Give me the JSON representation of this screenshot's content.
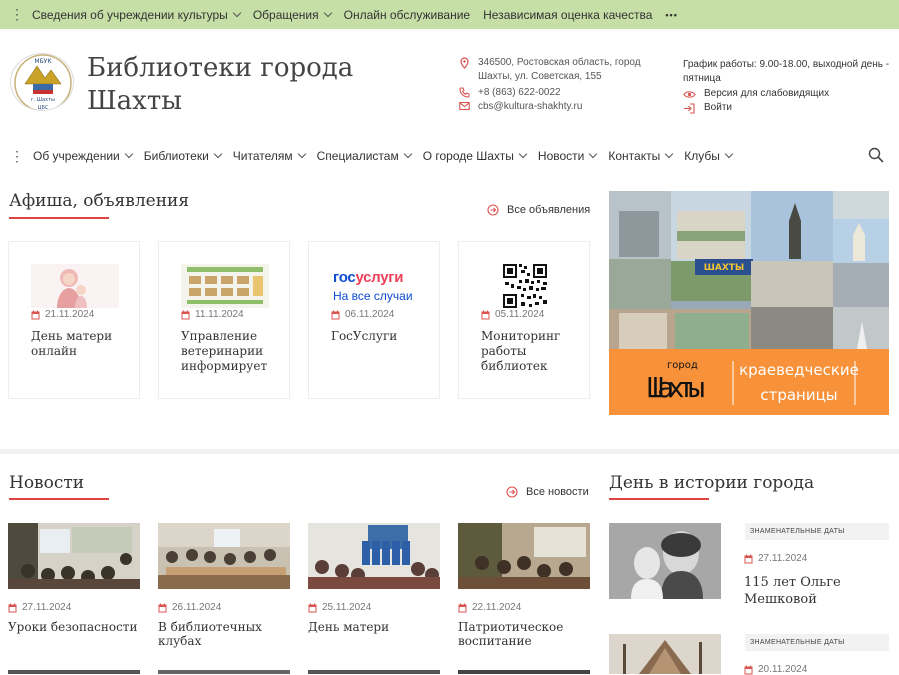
{
  "topbar": {
    "items": [
      {
        "label": "Сведения об учреждении культуры",
        "has_submenu": true
      },
      {
        "label": "Обращения",
        "has_submenu": true
      },
      {
        "label": "Онлайн обслуживание",
        "has_submenu": false
      },
      {
        "label": "Независимая оценка качества",
        "has_submenu": false
      }
    ],
    "more_label": "•••"
  },
  "header": {
    "logo_text_top": "МБУК",
    "logo_text_mid": "г. Шахты",
    "logo_text_bottom": "ЦБС",
    "title": "Библиотеки города Шахты",
    "address": "346500, Ростовская область, город Шахты, ул. Советская, 155",
    "phone": "+8 (863) 622-0022",
    "email": "cbs@kultura-shakhty.ru",
    "schedule": "График работы: 9.00-18.00, выходной день - пятница",
    "accessibility_label": "Версия для слабовидящих",
    "login_label": "Войти"
  },
  "nav": {
    "items": [
      "Об учреждении",
      "Библиотеки",
      "Читателям",
      "Специалистам",
      "О городе Шахты",
      "Новости",
      "Контакты",
      "Клубы"
    ]
  },
  "afisha": {
    "title": "Афиша, объявления",
    "more_label": "Все объявления",
    "cards": [
      {
        "date": "21.11.2024",
        "title": "День матери онлайн",
        "image": "mother-day"
      },
      {
        "date": "11.11.2024",
        "title": "Управление ветеринарии информирует",
        "image": "vet-poster"
      },
      {
        "date": "06.11.2024",
        "title": "ГосУслуги",
        "image": "gosuslugi-logo"
      },
      {
        "date": "05.11.2024",
        "title": "Мониторинг работы библиотек",
        "image": "qr-code"
      }
    ]
  },
  "gosuslugi": {
    "word_a": "гос",
    "word_b": "услуги",
    "tagline": "На все случаи"
  },
  "banner": {
    "small": "город",
    "city": "Шахты",
    "line1": "краеведческие",
    "line2": "страницы",
    "collage_sign": "ШАХТЫ"
  },
  "news": {
    "title": "Новости",
    "more_label": "Все новости",
    "cards": [
      {
        "date": "27.11.2024",
        "title": "Уроки безопасности"
      },
      {
        "date": "26.11.2024",
        "title": "В библиотечных клубах"
      },
      {
        "date": "25.11.2024",
        "title": "День матери"
      },
      {
        "date": "22.11.2024",
        "title": "Патриотическое воспитание"
      }
    ]
  },
  "history": {
    "title": "День в истории города",
    "cards": [
      {
        "tag": "ЗНАМЕНАТЕЛЬНЫЕ ДАТЫ",
        "date": "27.11.2024",
        "title": "115 лет Ольге Мешковой"
      },
      {
        "tag": "ЗНАМЕНАТЕЛЬНЫЕ ДАТЫ",
        "date": "20.11.2024",
        "title": ""
      }
    ]
  },
  "colors": {
    "topbar": "#c5dfa7",
    "accent": "#d44444",
    "banner_orange": "#f7923a",
    "date_icon": "#d9534f"
  }
}
